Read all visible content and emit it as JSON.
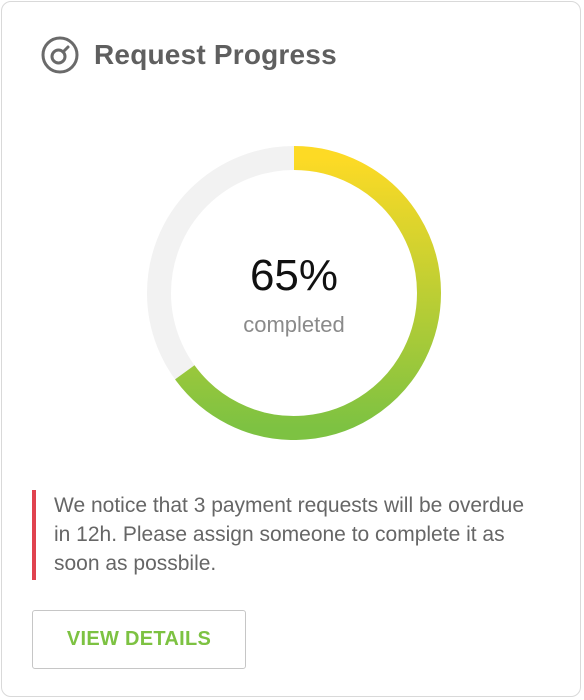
{
  "card": {
    "title": "Request Progress",
    "icon": "gauge-icon"
  },
  "progress": {
    "value": 65,
    "value_label": "65%",
    "caption": "completed",
    "track_color": "#f2f2f2",
    "gradient_start_color": "#fdda25",
    "gradient_end_color": "#7dc242"
  },
  "notice": {
    "text": "We notice that 3 payment requests will be overdue in 12h. Please assign someone to complete it as soon as possbile.",
    "accent_color": "#e0424f"
  },
  "actions": {
    "view_details_label": "VIEW DETAILS",
    "accent_color": "#7dc242"
  }
}
